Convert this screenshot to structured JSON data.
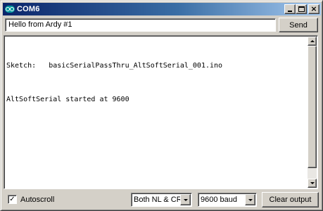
{
  "window": {
    "title": "COM6",
    "controls": {
      "minimize": "_",
      "maximize": "□",
      "close": "×"
    }
  },
  "input": {
    "value": "Hello from Ardy #1",
    "send_label": "Send"
  },
  "output": {
    "lines": [
      "Sketch:   basicSerialPassThru_AltSoftSerial_001.ino",
      "AltSoftSerial started at 9600"
    ]
  },
  "footer": {
    "autoscroll_label": "Autoscroll",
    "autoscroll_checked": "✓",
    "line_ending": "Both NL & CR",
    "baud_rate": "9600 baud",
    "clear_label": "Clear output"
  },
  "colors": {
    "title_bar_start": "#0a246a",
    "title_bar_end": "#a6caf0",
    "window_face": "#d4d0c8",
    "app_icon": "#00979d"
  }
}
